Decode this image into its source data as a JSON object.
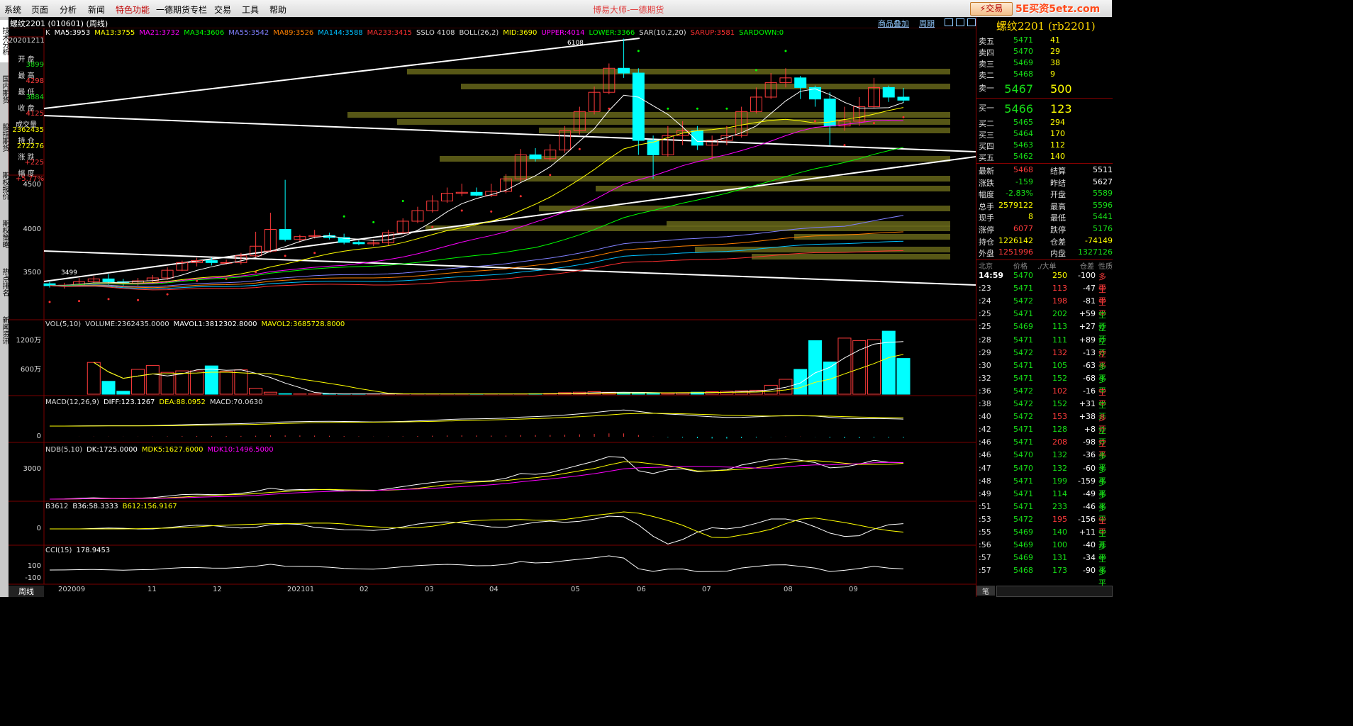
{
  "menu": {
    "items": [
      "系统",
      "页面",
      "分析",
      "新闻",
      "特色功能",
      "一德期货专栏",
      "交易",
      "工具",
      "帮助"
    ],
    "brand": "博易大师-一德期货",
    "trade_button": "交易",
    "site_logo": "5E买资5etz.com"
  },
  "left_tabs": [
    "技术分析",
    "国内期货",
    "股指期货",
    "期权报价",
    "期权策略",
    "热点排名",
    "新闻资讯"
  ],
  "chart_header": {
    "contract": "螺纹2201 (010601) (周线)",
    "link_overlay": "商品叠加",
    "link_period": "周期"
  },
  "side_info": [
    {
      "label": "20201211",
      "value": ""
    },
    {
      "label": "开 盘",
      "value": "3899",
      "color": "#17e017"
    },
    {
      "label": "最 高",
      "value": "4298",
      "color": "#ff3b3b"
    },
    {
      "label": "最 低",
      "value": "3884",
      "color": "#17e017"
    },
    {
      "label": "收 盘",
      "value": "4125",
      "color": "#ff3b3b"
    },
    {
      "label": "成交量",
      "value": "2362435",
      "color": "#ffff00"
    },
    {
      "label": "持 仓",
      "value": "272276",
      "color": "#ffff00"
    },
    {
      "label": "涨 跌",
      "value": "+225",
      "color": "#ff3b3b"
    },
    {
      "label": "幅 度",
      "value": "+5.77%",
      "color": "#ff3b3b"
    }
  ],
  "indicators": {
    "main": [
      {
        "text": "K",
        "color": "#dddddd"
      },
      {
        "text": "MA5:3953",
        "color": "#ffffff"
      },
      {
        "text": "MA13:3755",
        "color": "#ffff00"
      },
      {
        "text": "MA21:3732",
        "color": "#ff00ff"
      },
      {
        "text": "MA34:3606",
        "color": "#00ff00"
      },
      {
        "text": "MA55:3542",
        "color": "#8080ff"
      },
      {
        "text": "MA89:3526",
        "color": "#ff8000"
      },
      {
        "text": "MA144:3588",
        "color": "#00c0ff"
      },
      {
        "text": "MA233:3415",
        "color": "#ff3030"
      },
      {
        "text": "SSLO 4108",
        "color": "#dddddd"
      },
      {
        "text": "BOLL(26,2)",
        "color": "#dddddd"
      },
      {
        "text": "MID:3690",
        "color": "#ffff00"
      },
      {
        "text": "UPPER:4014",
        "color": "#ff00ff"
      },
      {
        "text": "LOWER:3366",
        "color": "#00ff00"
      },
      {
        "text": "SAR(10,2,20)",
        "color": "#dddddd"
      },
      {
        "text": "SARUP:3581",
        "color": "#ff3030"
      },
      {
        "text": "SARDOWN:0",
        "color": "#00ff00"
      }
    ],
    "vol": [
      {
        "text": "VOL(5,10)",
        "color": "#dddddd"
      },
      {
        "text": "VOLUME:2362435.0000",
        "color": "#dddddd"
      },
      {
        "text": "MAVOL1:3812302.8000",
        "color": "#ffffff"
      },
      {
        "text": "MAVOL2:3685728.8000",
        "color": "#ffff00"
      }
    ],
    "macd": [
      {
        "text": "MACD(12,26,9)",
        "color": "#dddddd"
      },
      {
        "text": "DIFF:123.1267",
        "color": "#ffffff"
      },
      {
        "text": "DEA:88.0952",
        "color": "#ffff00"
      },
      {
        "text": "MACD:70.0630",
        "color": "#dddddd"
      }
    ],
    "ndb": [
      {
        "text": "NDB(5,10)",
        "color": "#dddddd"
      },
      {
        "text": "DK:1725.0000",
        "color": "#ffffff"
      },
      {
        "text": "MDK5:1627.6000",
        "color": "#ffff00"
      },
      {
        "text": "MDK10:1496.5000",
        "color": "#ff00ff"
      }
    ],
    "b3612": [
      {
        "text": "B3612",
        "color": "#dddddd"
      },
      {
        "text": "B36:58.3333",
        "color": "#ffffff"
      },
      {
        "text": "B612:156.9167",
        "color": "#ffff00"
      }
    ],
    "cci": [
      {
        "text": "CCI(15)",
        "color": "#dddddd"
      },
      {
        "text": "178.9453",
        "color": "#ffffff"
      }
    ]
  },
  "main_axis_labels": [
    "4500",
    "4000",
    "3500"
  ],
  "vol_axis_labels": [
    "1200万",
    "600万"
  ],
  "macd_axis_label": "0",
  "ndb_axis_label": "3000",
  "b3612_axis_label": "0",
  "cci_axis_labels": [
    "100",
    "-100"
  ],
  "chart_annotations": {
    "high_label": "6108",
    "low_label": "3499"
  },
  "x_axis": {
    "period_tab": "周线",
    "labels": [
      "202009",
      "11",
      "12",
      "202101",
      "02",
      "03",
      "04",
      "05",
      "06",
      "07",
      "08",
      "09"
    ]
  },
  "right_panel": {
    "title": "螺纹2201 (rb2201)",
    "asks": [
      {
        "label": "卖五",
        "price": "5471",
        "vol": "41"
      },
      {
        "label": "卖四",
        "price": "5470",
        "vol": "29"
      },
      {
        "label": "卖三",
        "price": "5469",
        "vol": "38"
      },
      {
        "label": "卖二",
        "price": "5468",
        "vol": "9"
      },
      {
        "label": "卖一",
        "price": "5467",
        "vol": "500"
      }
    ],
    "bids": [
      {
        "label": "买一",
        "price": "5466",
        "vol": "123"
      },
      {
        "label": "买二",
        "price": "5465",
        "vol": "294"
      },
      {
        "label": "买三",
        "price": "5464",
        "vol": "170"
      },
      {
        "label": "买四",
        "price": "5463",
        "vol": "112"
      },
      {
        "label": "买五",
        "price": "5462",
        "vol": "140"
      }
    ],
    "stats": [
      {
        "l1": "最新",
        "v1": "5468",
        "c1": "#ff3b3b",
        "l2": "结算",
        "v2": "5511",
        "c2": "#ffffff"
      },
      {
        "l1": "涨跌",
        "v1": "-159",
        "c1": "#17e017",
        "l2": "昨结",
        "v2": "5627",
        "c2": "#ffffff"
      },
      {
        "l1": "幅度",
        "v1": "-2.83%",
        "c1": "#17e017",
        "l2": "开盘",
        "v2": "5589",
        "c2": "#17e017"
      },
      {
        "l1": "总手",
        "v1": "2579122",
        "c1": "#ffff00",
        "l2": "最高",
        "v2": "5596",
        "c2": "#17e017"
      },
      {
        "l1": "现手",
        "v1": "8",
        "c1": "#ffff00",
        "l2": "最低",
        "v2": "5441",
        "c2": "#17e017"
      },
      {
        "l1": "涨停",
        "v1": "6077",
        "c1": "#ff3b3b",
        "l2": "跌停",
        "v2": "5176",
        "c2": "#17e017"
      },
      {
        "l1": "持仓",
        "v1": "1226142",
        "c1": "#ffff00",
        "l2": "仓差",
        "v2": "-74149",
        "c2": "#ffff00"
      },
      {
        "l1": "外盘",
        "v1": "1251996",
        "c1": "#ff3b3b",
        "l2": "内盘",
        "v2": "1327126",
        "c2": "#17e017"
      }
    ],
    "tick_header": {
      "loc": "北京",
      "price": "价格",
      "vol": "./大单",
      "oi": "仓差",
      "nature": "性质"
    },
    "ticks": [
      {
        "t": "14:59",
        "p": "5470",
        "v": "250",
        "o": "-100",
        "n": "多平",
        "vc": "#ffff00",
        "nc": "#ff3b3b"
      },
      {
        "t": ":23",
        "p": "5471",
        "v": "113",
        "o": "-47",
        "n": "空平",
        "vc": "#ff3b3b",
        "nc": "#ff3b3b"
      },
      {
        "t": ":24",
        "p": "5472",
        "v": "198",
        "o": "-81",
        "n": "空平",
        "vc": "#ff3b3b",
        "nc": "#ff3b3b"
      },
      {
        "t": ":25",
        "p": "5471",
        "v": "202",
        "o": "+59",
        "n": "空开",
        "vc": "#17e017",
        "nc": "#17e017"
      },
      {
        "t": ":25",
        "p": "5469",
        "v": "113",
        "o": "+27",
        "n": "空开",
        "vc": "#17e017",
        "nc": "#17e017"
      },
      {
        "t": ":28",
        "p": "5471",
        "v": "111",
        "o": "+89",
        "n": "空开",
        "vc": "#17e017",
        "nc": "#17e017"
      },
      {
        "t": ":29",
        "p": "5472",
        "v": "132",
        "o": "-13",
        "n": "空平",
        "vc": "#ff3b3b",
        "nc": "#ff3b3b"
      },
      {
        "t": ":30",
        "p": "5471",
        "v": "105",
        "o": "-63",
        "n": "多平",
        "vc": "#17e017",
        "nc": "#17e017"
      },
      {
        "t": ":32",
        "p": "5471",
        "v": "152",
        "o": "-68",
        "n": "多平",
        "vc": "#17e017",
        "nc": "#17e017"
      },
      {
        "t": ":36",
        "p": "5472",
        "v": "102",
        "o": "-16",
        "n": "空平",
        "vc": "#ff3b3b",
        "nc": "#ff3b3b"
      },
      {
        "t": ":38",
        "p": "5472",
        "v": "152",
        "o": "+31",
        "n": "空开",
        "vc": "#17e017",
        "nc": "#17e017"
      },
      {
        "t": ":40",
        "p": "5472",
        "v": "153",
        "o": "+38",
        "n": "多开",
        "vc": "#ff3b3b",
        "nc": "#ff3b3b"
      },
      {
        "t": ":42",
        "p": "5471",
        "v": "128",
        "o": "+8",
        "n": "空开",
        "vc": "#17e017",
        "nc": "#17e017"
      },
      {
        "t": ":46",
        "p": "5471",
        "v": "208",
        "o": "-98",
        "n": "空平",
        "vc": "#ff3b3b",
        "nc": "#ff3b3b"
      },
      {
        "t": ":46",
        "p": "5470",
        "v": "132",
        "o": "-36",
        "n": "多平",
        "vc": "#17e017",
        "nc": "#17e017"
      },
      {
        "t": ":47",
        "p": "5470",
        "v": "132",
        "o": "-60",
        "n": "多平",
        "vc": "#17e017",
        "nc": "#17e017"
      },
      {
        "t": ":48",
        "p": "5471",
        "v": "199",
        "o": "-159",
        "n": "多平",
        "vc": "#17e017",
        "nc": "#17e017"
      },
      {
        "t": ":49",
        "p": "5471",
        "v": "114",
        "o": "-49",
        "n": "多平",
        "vc": "#17e017",
        "nc": "#17e017"
      },
      {
        "t": ":51",
        "p": "5471",
        "v": "233",
        "o": "-46",
        "n": "多平",
        "vc": "#17e017",
        "nc": "#17e017"
      },
      {
        "t": ":53",
        "p": "5472",
        "v": "195",
        "o": "-156",
        "n": "空平",
        "vc": "#ff3b3b",
        "nc": "#ff3b3b"
      },
      {
        "t": ":55",
        "p": "5469",
        "v": "140",
        "o": "+11",
        "n": "空开",
        "vc": "#17e017",
        "nc": "#17e017"
      },
      {
        "t": ":56",
        "p": "5469",
        "v": "100",
        "o": "-40",
        "n": "多平",
        "vc": "#17e017",
        "nc": "#17e017"
      },
      {
        "t": ":57",
        "p": "5469",
        "v": "131",
        "o": "-34",
        "n": "空平",
        "vc": "#17e017",
        "nc": "#17e017"
      },
      {
        "t": ":57",
        "p": "5468",
        "v": "173",
        "o": "-90",
        "n": "多平",
        "vc": "#17e017",
        "nc": "#17e017"
      }
    ],
    "bottom_tab": "笔"
  },
  "chart_data": {
    "type": "candlestick",
    "period": "weekly",
    "title": "螺纹2201 (010601) (周线)",
    "x_labels": [
      "202009",
      "11",
      "12",
      "202101",
      "02",
      "03",
      "04",
      "05",
      "06",
      "07",
      "08",
      "09"
    ],
    "candles": [
      {
        "o": 3560,
        "c": 3540,
        "h": 3580,
        "l": 3520
      },
      {
        "o": 3540,
        "c": 3545,
        "h": 3570,
        "l": 3510
      },
      {
        "o": 3545,
        "c": 3580,
        "h": 3620,
        "l": 3530
      },
      {
        "o": 3580,
        "c": 3610,
        "h": 3640,
        "l": 3560
      },
      {
        "o": 3610,
        "c": 3580,
        "h": 3660,
        "l": 3550
      },
      {
        "o": 3580,
        "c": 3560,
        "h": 3610,
        "l": 3540
      },
      {
        "o": 3560,
        "c": 3590,
        "h": 3620,
        "l": 3540
      },
      {
        "o": 3590,
        "c": 3620,
        "h": 3650,
        "l": 3570
      },
      {
        "o": 3620,
        "c": 3700,
        "h": 3730,
        "l": 3600
      },
      {
        "o": 3700,
        "c": 3780,
        "h": 3800,
        "l": 3690
      },
      {
        "o": 3780,
        "c": 3800,
        "h": 3830,
        "l": 3740
      },
      {
        "o": 3800,
        "c": 3780,
        "h": 3830,
        "l": 3750
      },
      {
        "o": 3780,
        "c": 3780,
        "h": 3810,
        "l": 3760
      },
      {
        "o": 3780,
        "c": 3850,
        "h": 3880,
        "l": 3760
      },
      {
        "o": 3850,
        "c": 3950,
        "h": 4100,
        "l": 3830
      },
      {
        "o": 3899,
        "c": 4125,
        "h": 4298,
        "l": 3884
      },
      {
        "o": 4125,
        "c": 4020,
        "h": 4640,
        "l": 4000
      },
      {
        "o": 4020,
        "c": 4050,
        "h": 4070,
        "l": 3990
      },
      {
        "o": 4050,
        "c": 4060,
        "h": 4120,
        "l": 4030
      },
      {
        "o": 4060,
        "c": 4040,
        "h": 4090,
        "l": 4020
      },
      {
        "o": 4040,
        "c": 3990,
        "h": 4080,
        "l": 3970
      },
      {
        "o": 3990,
        "c": 3975,
        "h": 4010,
        "l": 3960
      },
      {
        "o": 3975,
        "c": 3985,
        "h": 4020,
        "l": 3950
      },
      {
        "o": 3985,
        "c": 4090,
        "h": 4120,
        "l": 3960
      },
      {
        "o": 4090,
        "c": 4210,
        "h": 4240,
        "l": 4080
      },
      {
        "o": 4210,
        "c": 4320,
        "h": 4360,
        "l": 4190
      },
      {
        "o": 4320,
        "c": 4420,
        "h": 4480,
        "l": 4300
      },
      {
        "o": 4420,
        "c": 4500,
        "h": 4560,
        "l": 4400
      },
      {
        "o": 4500,
        "c": 4510,
        "h": 4600,
        "l": 4470
      },
      {
        "o": 4510,
        "c": 4480,
        "h": 4560,
        "l": 4470
      },
      {
        "o": 4480,
        "c": 4520,
        "h": 4600,
        "l": 4460
      },
      {
        "o": 4520,
        "c": 4650,
        "h": 4700,
        "l": 4500
      },
      {
        "o": 4650,
        "c": 4900,
        "h": 4960,
        "l": 4620
      },
      {
        "o": 4900,
        "c": 4860,
        "h": 4970,
        "l": 4830
      },
      {
        "o": 4860,
        "c": 4950,
        "h": 5010,
        "l": 4840
      },
      {
        "o": 4950,
        "c": 5150,
        "h": 5200,
        "l": 4920
      },
      {
        "o": 5150,
        "c": 5350,
        "h": 5400,
        "l": 5110
      },
      {
        "o": 5350,
        "c": 5550,
        "h": 5610,
        "l": 5320
      },
      {
        "o": 5550,
        "c": 5800,
        "h": 5850,
        "l": 5530
      },
      {
        "o": 5800,
        "c": 5750,
        "h": 6108,
        "l": 5700
      },
      {
        "o": 5750,
        "c": 5050,
        "h": 5800,
        "l": 4900
      },
      {
        "o": 5050,
        "c": 4900,
        "h": 5100,
        "l": 4650
      },
      {
        "o": 4900,
        "c": 5100,
        "h": 5200,
        "l": 4880
      },
      {
        "o": 5100,
        "c": 5150,
        "h": 5250,
        "l": 5000
      },
      {
        "o": 5150,
        "c": 5000,
        "h": 5200,
        "l": 4950
      },
      {
        "o": 5000,
        "c": 5050,
        "h": 5100,
        "l": 4850
      },
      {
        "o": 5050,
        "c": 5100,
        "h": 5200,
        "l": 5000
      },
      {
        "o": 5100,
        "c": 5350,
        "h": 5400,
        "l": 5080
      },
      {
        "o": 5350,
        "c": 5500,
        "h": 5600,
        "l": 5330
      },
      {
        "o": 5500,
        "c": 5650,
        "h": 5750,
        "l": 5480
      },
      {
        "o": 5650,
        "c": 5700,
        "h": 5800,
        "l": 5600
      },
      {
        "o": 5700,
        "c": 5600,
        "h": 5720,
        "l": 5480
      },
      {
        "o": 5600,
        "c": 5480,
        "h": 5620,
        "l": 5400
      },
      {
        "o": 5480,
        "c": 5200,
        "h": 5550,
        "l": 5000
      },
      {
        "o": 5200,
        "c": 5250,
        "h": 5400,
        "l": 5150
      },
      {
        "o": 5250,
        "c": 5400,
        "h": 5500,
        "l": 5200
      },
      {
        "o": 5400,
        "c": 5600,
        "h": 5700,
        "l": 5380
      },
      {
        "o": 5600,
        "c": 5500,
        "h": 5620,
        "l": 5450
      },
      {
        "o": 5500,
        "c": 5468,
        "h": 5596,
        "l": 5441
      }
    ],
    "volume_wan": [
      640,
      260,
      60,
      500,
      580,
      440,
      470,
      470,
      570,
      460,
      490,
      120,
      40,
      10,
      5,
      5,
      5,
      5,
      5,
      5,
      5,
      5,
      5,
      5,
      5,
      5,
      5,
      5,
      5,
      5,
      10,
      15,
      30,
      40,
      50,
      40,
      30,
      25,
      20,
      20,
      30,
      40,
      50,
      60,
      70,
      80,
      180,
      300,
      500,
      1080,
      650,
      1130,
      1080,
      1100,
      1270,
      720
    ],
    "main_ylim": [
      3200,
      6200
    ],
    "main_axis_ticks": [
      4500,
      4000,
      3500
    ],
    "vol_axis_ticks_wan": [
      1200,
      600
    ]
  }
}
